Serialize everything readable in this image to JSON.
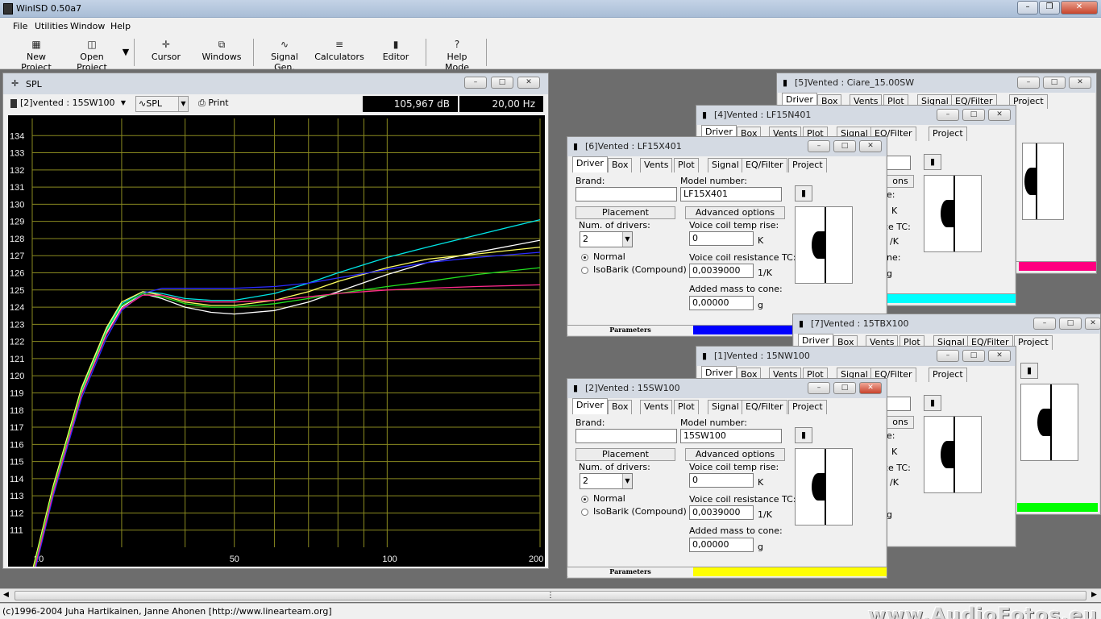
{
  "app": {
    "title": "WinISD 0.50a7"
  },
  "menu": [
    "File",
    "Utilities",
    "Window",
    "Help"
  ],
  "toolbar": [
    {
      "label": "New Project",
      "icon": "new-project-icon"
    },
    {
      "label": "Open Project",
      "icon": "open-folder-icon"
    },
    {
      "label": "Cursor",
      "icon": "crosshair-icon"
    },
    {
      "label": "Windows",
      "icon": "windows-icon"
    },
    {
      "label": "Signal Gen.",
      "icon": "sine-wave-icon"
    },
    {
      "label": "Calculators",
      "icon": "calculator-icon"
    },
    {
      "label": "Editor",
      "icon": "speaker-icon"
    },
    {
      "label": "Help Mode",
      "icon": "question-icon"
    }
  ],
  "spl": {
    "title": "SPL",
    "project_select": "[2]vented : 15SW100",
    "graph_select": "SPL",
    "print_label": "Print",
    "readout_db": "105,967 dB",
    "readout_hz": "20,00 Hz"
  },
  "chart_data": {
    "type": "line",
    "xscale": "log",
    "xlim": [
      20,
      200
    ],
    "ylim": [
      110,
      135
    ],
    "x_ticks": [
      "20",
      "50",
      "100",
      "200"
    ],
    "y_ticks": [
      "111",
      "112",
      "113",
      "114",
      "115",
      "116",
      "117",
      "118",
      "119",
      "120",
      "121",
      "122",
      "123",
      "124",
      "125",
      "126",
      "127",
      "128",
      "129",
      "130",
      "131",
      "132",
      "133",
      "134"
    ],
    "grid": true,
    "x": [
      20,
      22,
      25,
      28,
      30,
      33,
      36,
      40,
      45,
      50,
      60,
      70,
      80,
      100,
      120,
      150,
      200
    ],
    "series": [
      {
        "color": "#00e5e5",
        "values": [
          108.5,
          113.5,
          119.2,
          122.7,
          124.2,
          124.9,
          124.8,
          124.5,
          124.4,
          124.4,
          124.8,
          125.4,
          126.0,
          126.9,
          127.5,
          128.2,
          129.1
        ]
      },
      {
        "color": "#ffffff",
        "values": [
          108.3,
          113.3,
          119.0,
          122.5,
          124.0,
          124.8,
          124.5,
          124.0,
          123.7,
          123.6,
          123.8,
          124.3,
          124.9,
          125.9,
          126.6,
          127.2,
          127.9
        ]
      },
      {
        "color": "#ffff60",
        "values": [
          108.6,
          113.6,
          119.3,
          122.8,
          124.3,
          124.9,
          124.7,
          124.3,
          124.1,
          124.1,
          124.4,
          124.9,
          125.5,
          126.3,
          126.8,
          127.1,
          127.5
        ]
      },
      {
        "color": "#2a2aff",
        "values": [
          108.0,
          113.0,
          118.7,
          122.2,
          123.8,
          124.8,
          125.1,
          125.1,
          125.1,
          125.1,
          125.2,
          125.4,
          125.7,
          126.2,
          126.6,
          126.9,
          127.2
        ]
      },
      {
        "color": "#20e020",
        "values": [
          108.4,
          113.4,
          119.1,
          122.6,
          124.1,
          124.8,
          124.6,
          124.2,
          124.0,
          124.0,
          124.2,
          124.5,
          124.8,
          125.2,
          125.5,
          125.9,
          126.3
        ]
      },
      {
        "color": "#ff2a8a",
        "values": [
          108.2,
          113.2,
          118.9,
          122.4,
          123.9,
          124.7,
          124.7,
          124.4,
          124.3,
          124.3,
          124.4,
          124.6,
          124.8,
          125.0,
          125.1,
          125.2,
          125.3
        ]
      }
    ]
  },
  "windows": {
    "w5": {
      "title": "[5]Vented : Ciare_15.00SW",
      "color": "#ff0080"
    },
    "w4": {
      "title": "[4]Vented : LF15N401",
      "color": "#00ffff"
    },
    "w6": {
      "title": "[6]Vented : LF15X401",
      "model": "LF15X401",
      "color": "#0000ff"
    },
    "w7": {
      "title": "[7]Vented : 15TBX100"
    },
    "w1": {
      "title": "[1]Vented : 15NW100",
      "color": "#00ff00"
    },
    "w2": {
      "title": "[2]Vented : 15SW100",
      "model": "15SW100",
      "color": "#ffff00"
    }
  },
  "driver_tab": {
    "tabs": [
      "Driver",
      "Box",
      "Vents",
      "Plot",
      "Signal",
      "EQ/Filter",
      "Project"
    ],
    "brand_label": "Brand:",
    "model_label": "Model number:",
    "placement": "Placement",
    "advanced": "Advanced options",
    "num_drivers_label": "Num. of drivers:",
    "num_drivers": "2",
    "normal": "Normal",
    "isobarik": "IsoBarik (Compound)",
    "vc_temp_label": "Voice coil temp rise:",
    "vc_temp": "0",
    "vc_temp_unit": "K",
    "vc_res_label": "Voice coil resistance TC:",
    "vc_res": "0,0039000",
    "vc_res_unit": "1/K",
    "mass_label": "Added mass to cone:",
    "mass": "0,00000",
    "mass_unit": "g",
    "parameters": "Parameters"
  },
  "peek": {
    "ons": "ons",
    "e": "e:",
    "k": "K",
    "ce_tc": "ce TC:",
    "per_k": "/K",
    "ne": "ne:",
    "g": "g",
    "sg": "g",
    "o": "o"
  },
  "status": {
    "text": "(c)1996-2004 Juha Hartikainen, Janne Ahonen [http://www.linearteam.org]",
    "watermark": "www.AudioFotos.eu"
  }
}
